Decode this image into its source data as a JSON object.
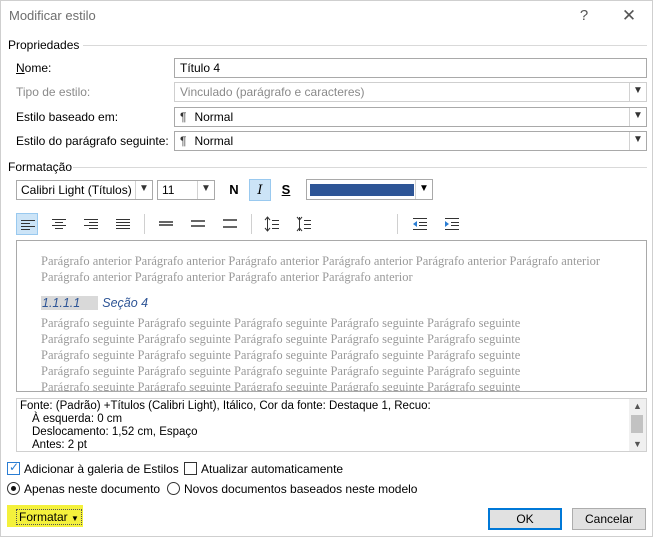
{
  "window": {
    "title": "Modificar estilo",
    "help_label": "?",
    "close_label": "✕"
  },
  "properties": {
    "section_label": "Propriedades",
    "name_label": "Nome:",
    "name_value": "Título 4",
    "type_label": "Tipo de estilo:",
    "type_value": "Vinculado (parágrafo e caracteres)",
    "based_on_label": "Estilo baseado em:",
    "based_on_value": "Normal",
    "next_label": "Estilo do parágrafo seguinte:",
    "next_value": "Normal",
    "pilcrow": "¶"
  },
  "formatting": {
    "section_label": "Formatação",
    "font": "Calibri Light (Títulos)",
    "size": "11",
    "bold_label": "N",
    "italic_label": "I",
    "underline_label": "S",
    "font_color": "#2e5596"
  },
  "preview": {
    "previous_text": "Parágrafo anterior Parágrafo anterior Parágrafo anterior Parágrafo anterior Parágrafo anterior Parágrafo anterior Parágrafo anterior Parágrafo anterior Parágrafo anterior Parágrafo anterior",
    "heading_number": "1.1.1.1",
    "heading_text": "Seção 4",
    "next_lines": [
      "Parágrafo seguinte Parágrafo seguinte Parágrafo seguinte Parágrafo seguinte Parágrafo seguinte",
      "Parágrafo seguinte Parágrafo seguinte Parágrafo seguinte Parágrafo seguinte Parágrafo seguinte",
      "Parágrafo seguinte Parágrafo seguinte Parágrafo seguinte Parágrafo seguinte Parágrafo seguinte",
      "Parágrafo seguinte Parágrafo seguinte Parágrafo seguinte Parágrafo seguinte Parágrafo seguinte",
      "Parágrafo seguinte Parágrafo seguinte Parágrafo seguinte Parágrafo seguinte Parágrafo seguinte"
    ]
  },
  "description": {
    "line1": "Fonte: (Padrão) +Títulos (Calibri Light), Itálico, Cor da fonte: Destaque 1, Recuo:",
    "line2": "À esquerda:  0 cm",
    "line3": "Deslocamento:  1,52 cm, Espaço",
    "line4": "Antes:  2 pt"
  },
  "options": {
    "add_gallery": "Adicionar à galeria de Estilos",
    "auto_update": "Atualizar automaticamente",
    "only_doc": "Apenas neste documento",
    "new_docs": "Novos documentos baseados neste modelo"
  },
  "buttons": {
    "format": "Formatar",
    "ok": "OK",
    "cancel": "Cancelar"
  }
}
